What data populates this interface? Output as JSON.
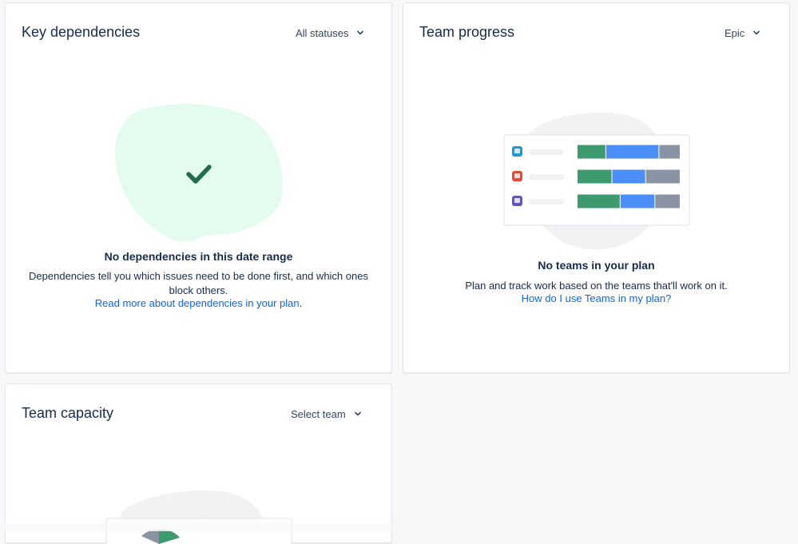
{
  "key_dependencies": {
    "title": "Key dependencies",
    "filter_label": "All statuses",
    "empty_title": "No dependencies in this date range",
    "empty_desc_line1": "Dependencies tell you which issues need to be done first, and which ones",
    "empty_desc_line2": "block others.",
    "link_text": "Read more about dependencies in your plan",
    "link_suffix": "."
  },
  "team_progress": {
    "title": "Team progress",
    "filter_label": "Epic",
    "empty_title": "No teams in your plan",
    "empty_desc": "Plan and track work based on the teams that'll work on it.",
    "link_text": "How do I use Teams in my plan?",
    "rows": [
      {
        "icon_color": "#1d9bd1",
        "segments": [
          0.28,
          0.52,
          0.2
        ]
      },
      {
        "icon_color": "#e5493a",
        "segments": [
          0.34,
          0.33,
          0.33
        ]
      },
      {
        "icon_color": "#6554c0",
        "segments": [
          0.42,
          0.34,
          0.24
        ]
      }
    ]
  },
  "team_capacity": {
    "title": "Team capacity",
    "filter_label": "Select team"
  },
  "colors": {
    "green_blob": "#e3fcef",
    "check": "#216e4e",
    "bar_green": "#3d9a6f",
    "bar_blue": "#4c8ef7",
    "bar_gray": "#8993a4",
    "link": "#0c66e4"
  },
  "icons": [
    "chevron-down-icon",
    "check-icon"
  ]
}
